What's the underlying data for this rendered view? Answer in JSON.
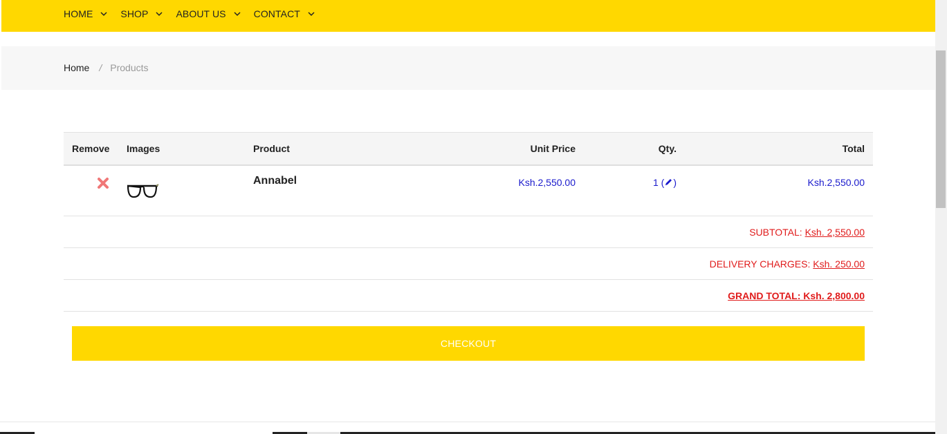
{
  "nav": {
    "items": [
      {
        "label": "HOME"
      },
      {
        "label": "SHOP"
      },
      {
        "label": "ABOUT US"
      },
      {
        "label": "CONTACT"
      }
    ],
    "icon": "chevron-down-icon",
    "background": "#ffd800"
  },
  "breadcrumb": {
    "home": "Home",
    "separator": "/",
    "current": "Products"
  },
  "cart": {
    "headers": {
      "remove": "Remove",
      "images": "Images",
      "product": "Product",
      "unit_price": "Unit Price",
      "qty": "Qty.",
      "total": "Total"
    },
    "items": [
      {
        "name": "Annabel",
        "unit_price": "Ksh.2,550.00",
        "qty": "1",
        "total": "Ksh.2,550.00",
        "image_icon": "eyeglasses-icon",
        "remove_icon": "close-icon",
        "edit_icon": "pencil-icon"
      }
    ],
    "subtotal": {
      "label": "SUBTOTAL:",
      "value": "Ksh. 2,550.00"
    },
    "delivery": {
      "label": "DELIVERY CHARGES:",
      "value": "Ksh. 250.00"
    },
    "grand_total": {
      "text": "GRAND TOTAL: Ksh. 2,800.00"
    }
  },
  "checkout": {
    "label": "CHECKOUT"
  },
  "colors": {
    "accent": "#ffd800",
    "price_blue": "#1a1acc",
    "summary_red": "#e01b1b",
    "remove_red": "#f07878"
  }
}
